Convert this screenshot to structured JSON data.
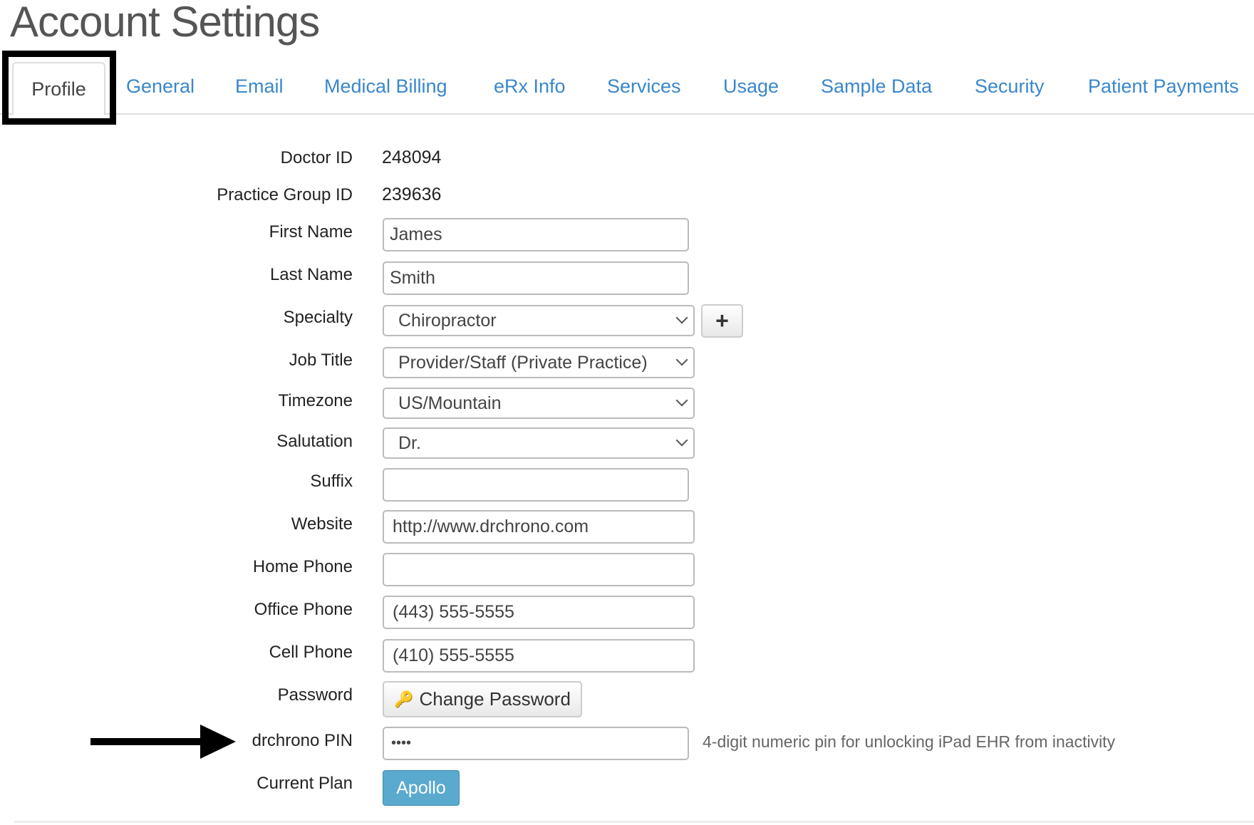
{
  "page_title": "Account Settings",
  "tabs": [
    {
      "label": "Profile",
      "active": true
    },
    {
      "label": "General"
    },
    {
      "label": "Email"
    },
    {
      "label": "Medical Billing"
    },
    {
      "label": "eRx Info"
    },
    {
      "label": "Services"
    },
    {
      "label": "Usage"
    },
    {
      "label": "Sample Data"
    },
    {
      "label": "Security"
    },
    {
      "label": "Patient Payments"
    }
  ],
  "form": {
    "doctor_id": {
      "label": "Doctor ID",
      "value": "248094"
    },
    "practice_group_id": {
      "label": "Practice Group ID",
      "value": "239636"
    },
    "first_name": {
      "label": "First Name",
      "value": "James"
    },
    "last_name": {
      "label": "Last Name",
      "value": "Smith"
    },
    "specialty": {
      "label": "Specialty",
      "value": "Chiropractor",
      "add_icon": "plus-icon"
    },
    "job_title": {
      "label": "Job Title",
      "value": "Provider/Staff (Private Practice)"
    },
    "timezone": {
      "label": "Timezone",
      "value": "US/Mountain"
    },
    "salutation": {
      "label": "Salutation",
      "value": "Dr."
    },
    "suffix": {
      "label": "Suffix",
      "value": ""
    },
    "website": {
      "label": "Website",
      "value": "http://www.drchrono.com"
    },
    "home_phone": {
      "label": "Home Phone",
      "value": ""
    },
    "office_phone": {
      "label": "Office Phone",
      "value": "(443) 555-5555"
    },
    "cell_phone": {
      "label": "Cell Phone",
      "value": "(410) 555-5555"
    },
    "password": {
      "label": "Password",
      "button": "Change Password",
      "icon": "key-icon"
    },
    "pin": {
      "label": "drchrono PIN",
      "value": "••••",
      "help": "4-digit numeric pin for unlocking iPad EHR from inactivity"
    },
    "plan": {
      "label": "Current Plan",
      "value": "Apollo",
      "color": "#5aa9ce"
    }
  },
  "colors": {
    "tab_link": "#3a87cb",
    "highlight": "#000000"
  }
}
